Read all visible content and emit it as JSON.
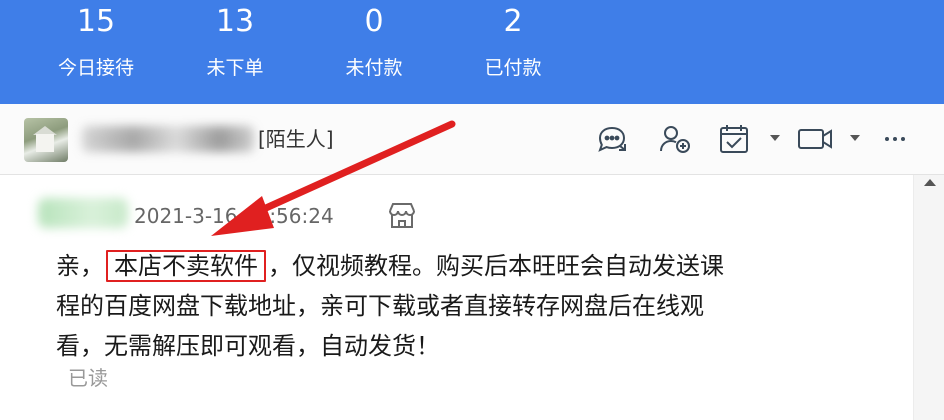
{
  "stats": [
    {
      "value": "15",
      "label": "今日接待"
    },
    {
      "value": "13",
      "label": "未下单"
    },
    {
      "value": "0",
      "label": "未付款"
    },
    {
      "value": "2",
      "label": "已付款"
    }
  ],
  "contact": {
    "tag": "[陌生人]"
  },
  "toolbar": {
    "icons": [
      "chat-transfer-icon",
      "add-contact-icon",
      "task-icon",
      "video-icon",
      "more-icon"
    ]
  },
  "message": {
    "timestamp": "2021-3-16 13:56:24",
    "line1_prefix": "亲，",
    "line1_highlight": "本店不卖软件",
    "line1_suffix": "，仅视频教程。购买后本旺旺会自动发送课",
    "line2": "程的百度网盘下载地址，亲可下载或者直接转存网盘后在线观",
    "line3": "看，无需解压即可观看，自动发货！",
    "read_status": "已读"
  },
  "colors": {
    "header_bg": "#3f7ee8",
    "annotation_red": "#e02020",
    "icon_gray": "#3a4a5a"
  }
}
